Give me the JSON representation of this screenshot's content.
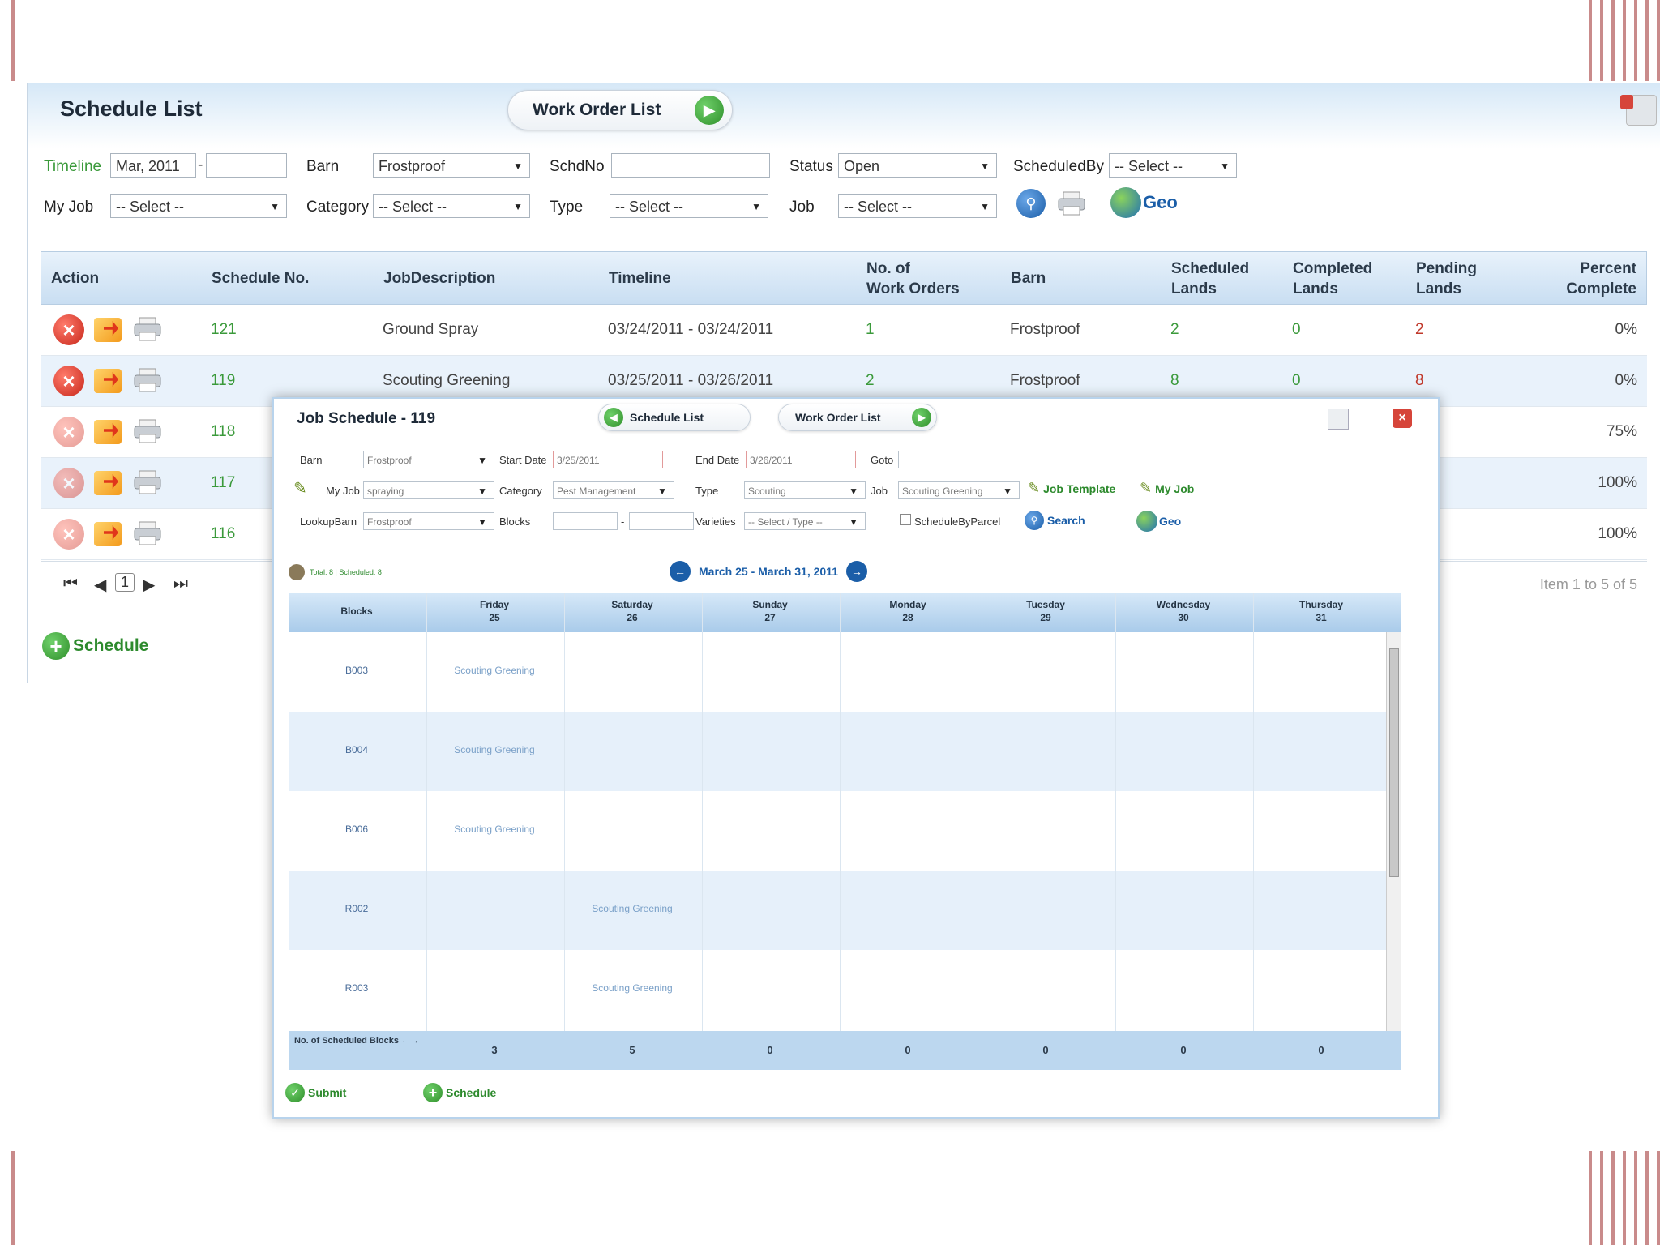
{
  "schedule_list": {
    "title": "Schedule List",
    "work_order_btn": "Work Order List",
    "filters": {
      "timeline_label": "Timeline",
      "timeline_from": "Mar, 2011",
      "timeline_sep": "-",
      "barn_label": "Barn",
      "barn_value": "Frostproof",
      "schdno_label": "SchdNo",
      "status_label": "Status",
      "status_value": "Open",
      "scheduledby_label": "ScheduledBy",
      "scheduledby_value": "-- Select --",
      "myjob_label": "My Job",
      "myjob_value": "-- Select --",
      "category_label": "Category",
      "category_value": "-- Select --",
      "type_label": "Type",
      "type_value": "-- Select --",
      "job_label": "Job",
      "job_value": "-- Select --",
      "geo_label": "Geo"
    },
    "columns": {
      "action": "Action",
      "schedule_no": "Schedule No.",
      "job_description": "JobDescription",
      "timeline": "Timeline",
      "no_work_orders": "No. of\nWork Orders",
      "barn": "Barn",
      "scheduled_lands": "Scheduled\nLands",
      "completed_lands": "Completed\nLands",
      "pending_lands": "Pending\nLands",
      "percent_complete": "Percent\nComplete"
    },
    "rows": [
      {
        "no": "121",
        "desc": "Ground Spray",
        "timeline": "03/24/2011 - 03/24/2011",
        "work_orders": "1",
        "barn": "Frostproof",
        "scheduled": "2",
        "completed": "0",
        "pending": "2",
        "percent": "0%"
      },
      {
        "no": "119",
        "desc": "Scouting Greening",
        "timeline": "03/25/2011 - 03/26/2011",
        "work_orders": "2",
        "barn": "Frostproof",
        "scheduled": "8",
        "completed": "0",
        "pending": "8",
        "percent": "0%"
      },
      {
        "no": "118",
        "percent": "75%"
      },
      {
        "no": "117",
        "percent": "100%"
      },
      {
        "no": "116",
        "percent": "100%"
      }
    ],
    "pager": {
      "page": "1",
      "summary": "Item 1 to 5 of 5"
    },
    "schedule_btn": "Schedule"
  },
  "job_schedule": {
    "title": "Job Schedule - 119",
    "schedule_list_btn": "Schedule List",
    "work_order_btn": "Work Order List",
    "form": {
      "barn_label": "Barn",
      "barn_value": "Frostproof",
      "start_label": "Start Date",
      "start_value": "3/25/2011",
      "end_label": "End Date",
      "end_value": "3/26/2011",
      "goto_label": "Goto",
      "myjob_label": "My Job",
      "myjob_value": "spraying",
      "category_label": "Category",
      "category_value": "Pest Management",
      "type_label": "Type",
      "type_value": "Scouting",
      "job_label": "Job",
      "job_value": "Scouting Greening",
      "job_template_link": "Job Template",
      "my_job_link": "My Job",
      "lookupbarn_label": "LookupBarn",
      "lookupbarn_value": "Frostproof",
      "blocks_label": "Blocks",
      "blocks_sep": "-",
      "varieties_label": "Varieties",
      "varieties_value": "-- Select / Type --",
      "schedulebyparcel_label": "ScheduleByParcel",
      "search_link": "Search",
      "geo_link": "Geo"
    },
    "totals": "Total: 8 | Scheduled: 8",
    "week_range": "March 25 - March 31, 2011",
    "calendar": {
      "blocks_header": "Blocks",
      "days": [
        {
          "name": "Friday",
          "date": "25"
        },
        {
          "name": "Saturday",
          "date": "26"
        },
        {
          "name": "Sunday",
          "date": "27"
        },
        {
          "name": "Monday",
          "date": "28"
        },
        {
          "name": "Tuesday",
          "date": "29"
        },
        {
          "name": "Wednesday",
          "date": "30"
        },
        {
          "name": "Thursday",
          "date": "31"
        }
      ],
      "rows": [
        {
          "block": "B003",
          "cells": [
            "Scouting Greening",
            "",
            "",
            "",
            "",
            "",
            ""
          ]
        },
        {
          "block": "B004",
          "cells": [
            "Scouting Greening",
            "",
            "",
            "",
            "",
            "",
            ""
          ]
        },
        {
          "block": "B006",
          "cells": [
            "Scouting Greening",
            "",
            "",
            "",
            "",
            "",
            ""
          ]
        },
        {
          "block": "R002",
          "cells": [
            "",
            "Scouting Greening",
            "",
            "",
            "",
            "",
            ""
          ]
        },
        {
          "block": "R003",
          "cells": [
            "",
            "Scouting Greening",
            "",
            "",
            "",
            "",
            ""
          ]
        }
      ],
      "footer_label": "No. of Scheduled Blocks ←→",
      "footer_counts": [
        "3",
        "5",
        "0",
        "0",
        "0",
        "0",
        "0"
      ]
    },
    "submit_btn": "Submit",
    "schedule_btn": "Schedule"
  },
  "colors": {
    "accent_green": "#3b9a3b",
    "header_blue": "#c9def2",
    "alt_row": "#e9f2fb",
    "danger_red": "#c7261a"
  }
}
